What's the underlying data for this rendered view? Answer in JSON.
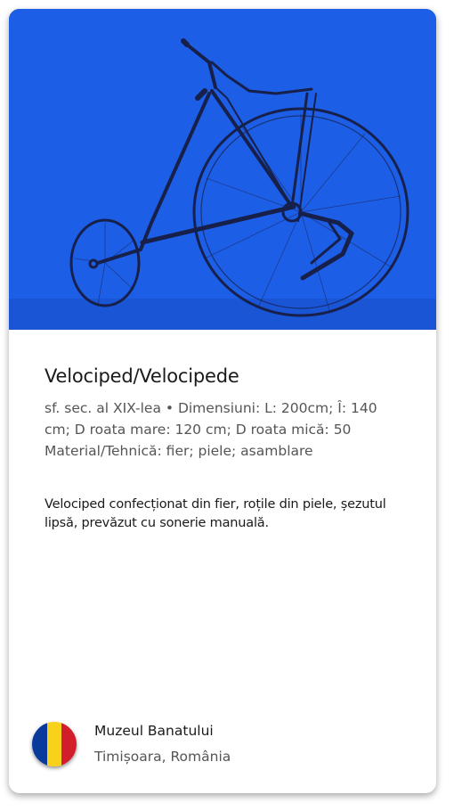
{
  "artifact": {
    "title": "Velociped/Velocipede",
    "meta_lines": [
      "sf. sec. al XIX-lea • Dimensiuni: L: 200cm; Î: 140 cm; D roata mare: 120 cm; D roata mică: 50",
      "Material/Tehnică: fier; piele; asamblare"
    ],
    "description": "Velociped confecționat din fier, roțile din piele, șezutul lipsă, prevăzut cu sonerie manuală."
  },
  "museum": {
    "name": "Muzeul Banatului",
    "location": "Timișoara, România"
  },
  "flag": {
    "colors": [
      "#0a3a9c",
      "#f7d11a",
      "#d21e2a"
    ]
  },
  "photo": {
    "background_color": "#1d5ee6",
    "subject_icon": "velocipede-illustration"
  }
}
